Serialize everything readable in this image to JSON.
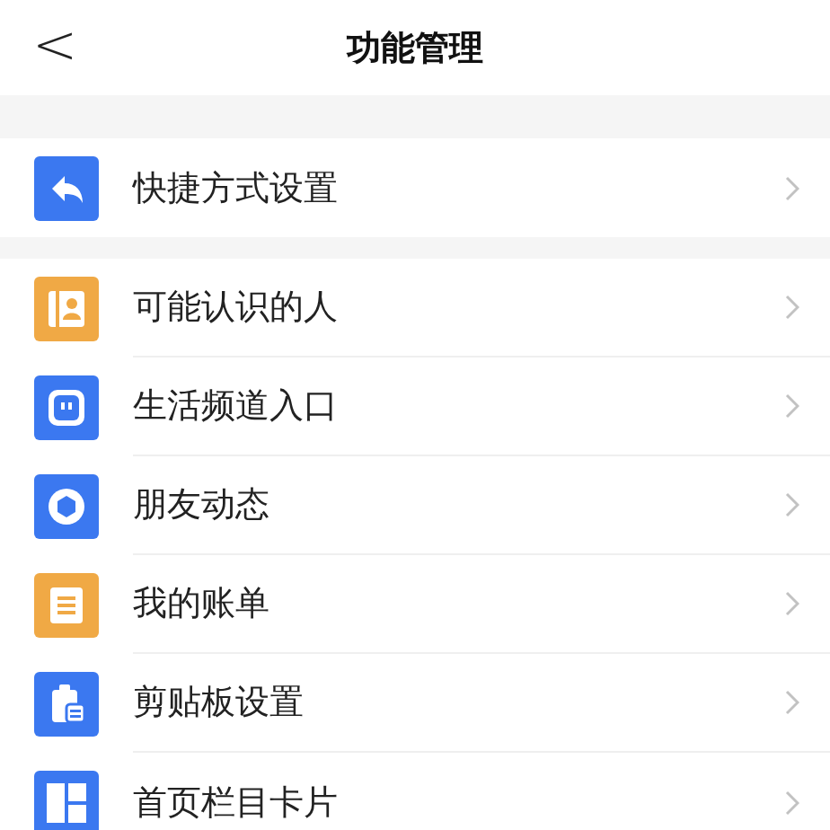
{
  "header": {
    "back": "<",
    "title": "功能管理"
  },
  "sections": [
    {
      "items": [
        {
          "label": "快捷方式设置",
          "kind": "reply",
          "color": "#3b78f0"
        }
      ]
    },
    {
      "items": [
        {
          "label": "可能认识的人",
          "kind": "contact",
          "color": "#f0a945"
        },
        {
          "label": "生活频道入口",
          "kind": "life",
          "color": "#3b78f0"
        },
        {
          "label": "朋友动态",
          "kind": "shutter",
          "color": "#3b78f0"
        },
        {
          "label": "我的账单",
          "kind": "bill",
          "color": "#f0a945"
        },
        {
          "label": "剪贴板设置",
          "kind": "clipboard",
          "color": "#3b78f0"
        },
        {
          "label": "首页栏目卡片",
          "kind": "grid",
          "color": "#3b78f0"
        }
      ]
    }
  ]
}
